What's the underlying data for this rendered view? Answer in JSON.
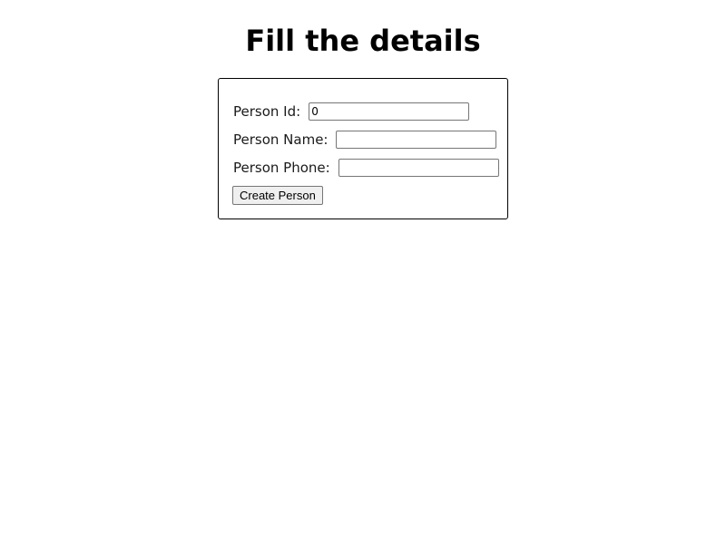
{
  "page": {
    "title": "Fill the details"
  },
  "form": {
    "person_id": {
      "label": "Person Id:",
      "value": "0"
    },
    "person_name": {
      "label": "Person Name:",
      "value": ""
    },
    "person_phone": {
      "label": "Person Phone:",
      "value": ""
    },
    "submit_label": "Create Person"
  }
}
